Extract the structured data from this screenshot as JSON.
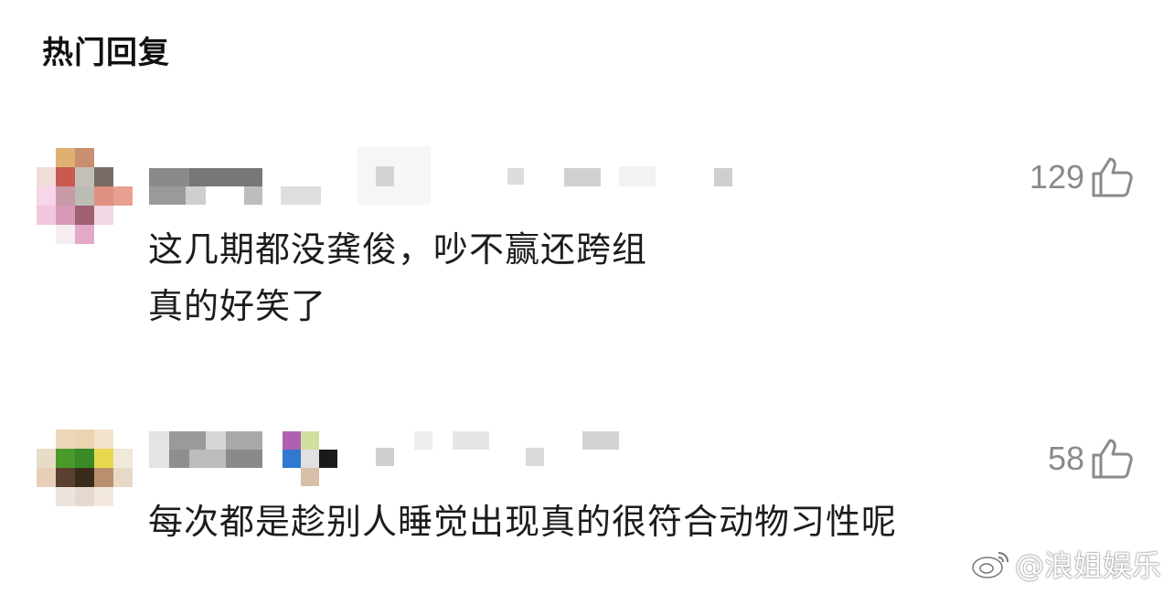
{
  "section": {
    "title": "热门回复"
  },
  "comments": [
    {
      "like_count": "129",
      "text_lines": [
        "这几期都没龚俊，吵不赢还跨组",
        "真的好笑了"
      ]
    },
    {
      "like_count": "58",
      "text_lines": [
        "每次都是趁别人睡觉出现真的很符合动物习性呢"
      ]
    }
  ],
  "watermark": {
    "text": "@浪姐娱乐",
    "icon": "weibo-icon"
  },
  "icons": {
    "like": "thumbs-up-icon"
  },
  "colors": {
    "like_count": "#8a8a8a",
    "text": "#1c1c1c"
  }
}
